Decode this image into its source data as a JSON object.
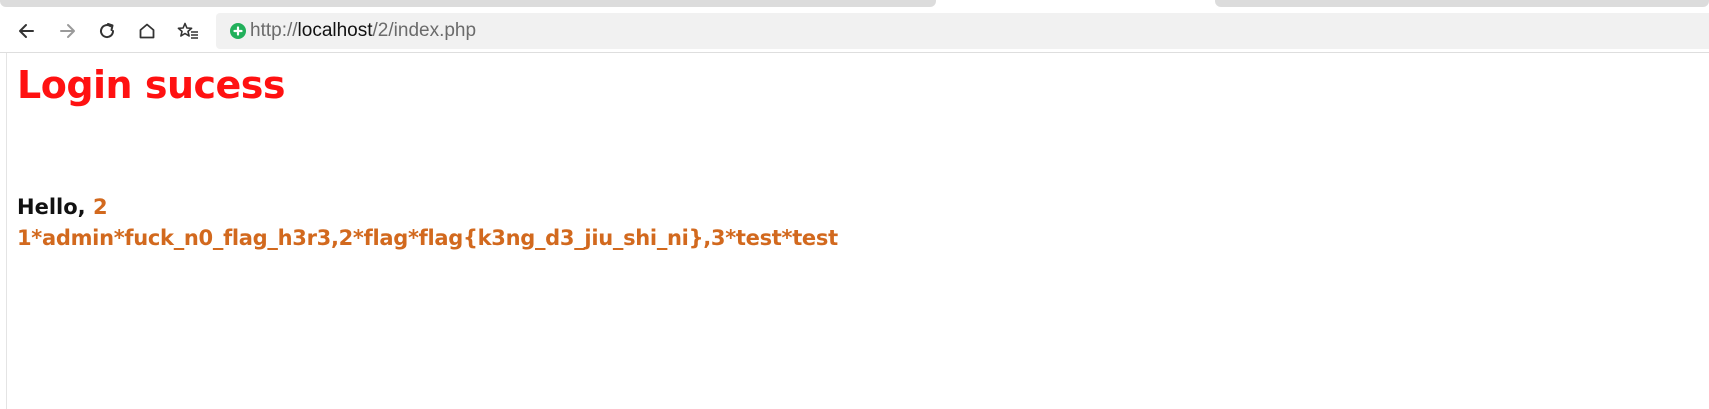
{
  "browser": {
    "url_scheme": "http://",
    "url_host": "localhost",
    "url_path": "/2/index.php",
    "secure_icon_color": "#22b05b"
  },
  "page": {
    "title": "Login sucess",
    "greeting_label": "Hello,",
    "greeting_value": "2",
    "result_text": "1*admin*fuck_n0_flag_h3r3,2*flag*flag{k3ng_d3_jiu_shi_ni},3*test*test",
    "title_color": "#ff1111",
    "value_color": "#d2691e"
  }
}
